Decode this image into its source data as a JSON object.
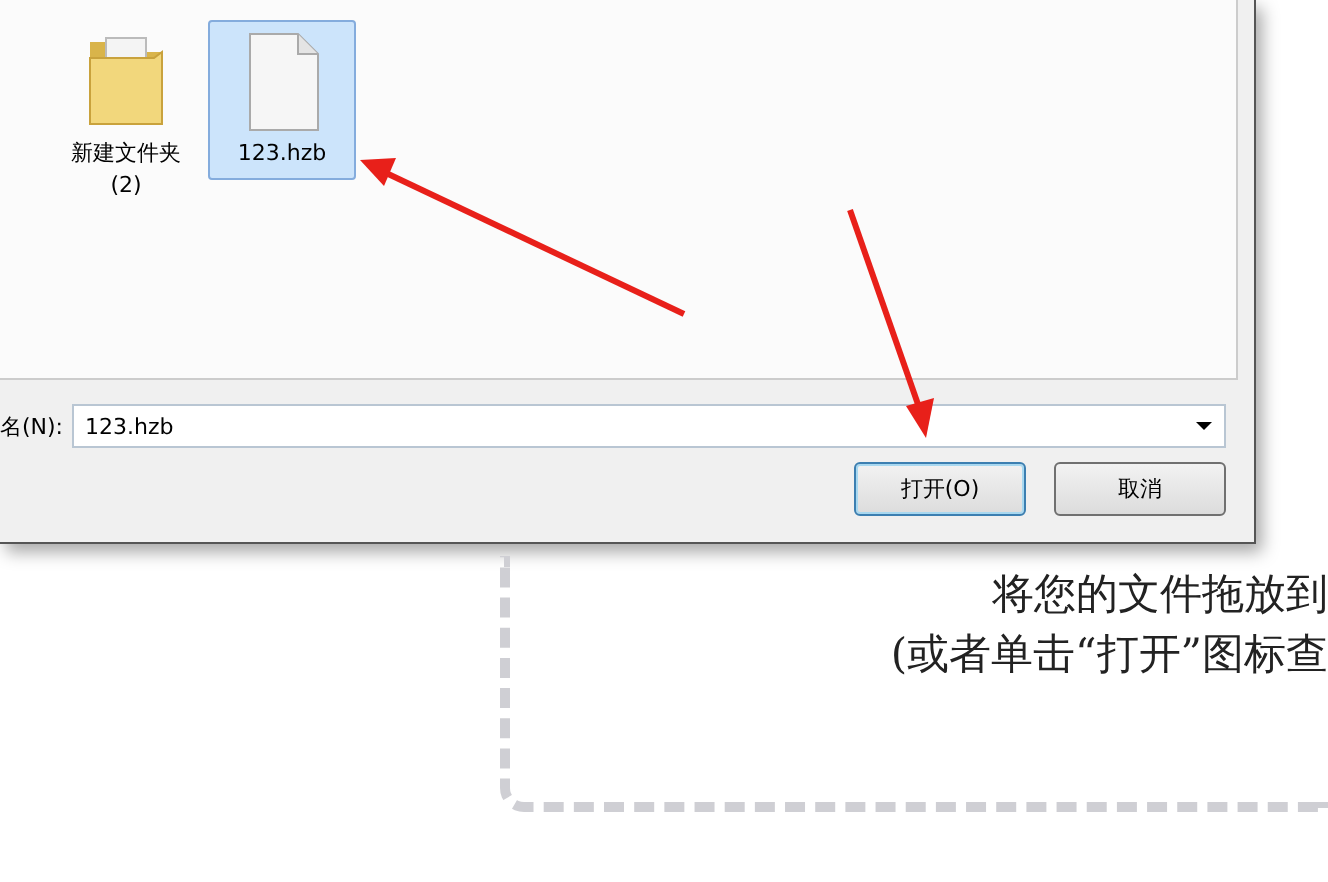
{
  "files": [
    {
      "name": "新建文件夹 (2)",
      "kind": "folder",
      "selected": false
    },
    {
      "name": "123.hzb",
      "kind": "file",
      "selected": true
    }
  ],
  "filename": {
    "label": "名(N):",
    "value": "123.hzb"
  },
  "buttons": [
    {
      "label": "打开(O)",
      "default": true
    },
    {
      "label": "取消",
      "default": false
    }
  ],
  "drop_zone": {
    "lines": [
      "将您的文件拖放到",
      "(或者单击“打开”图标查"
    ]
  }
}
